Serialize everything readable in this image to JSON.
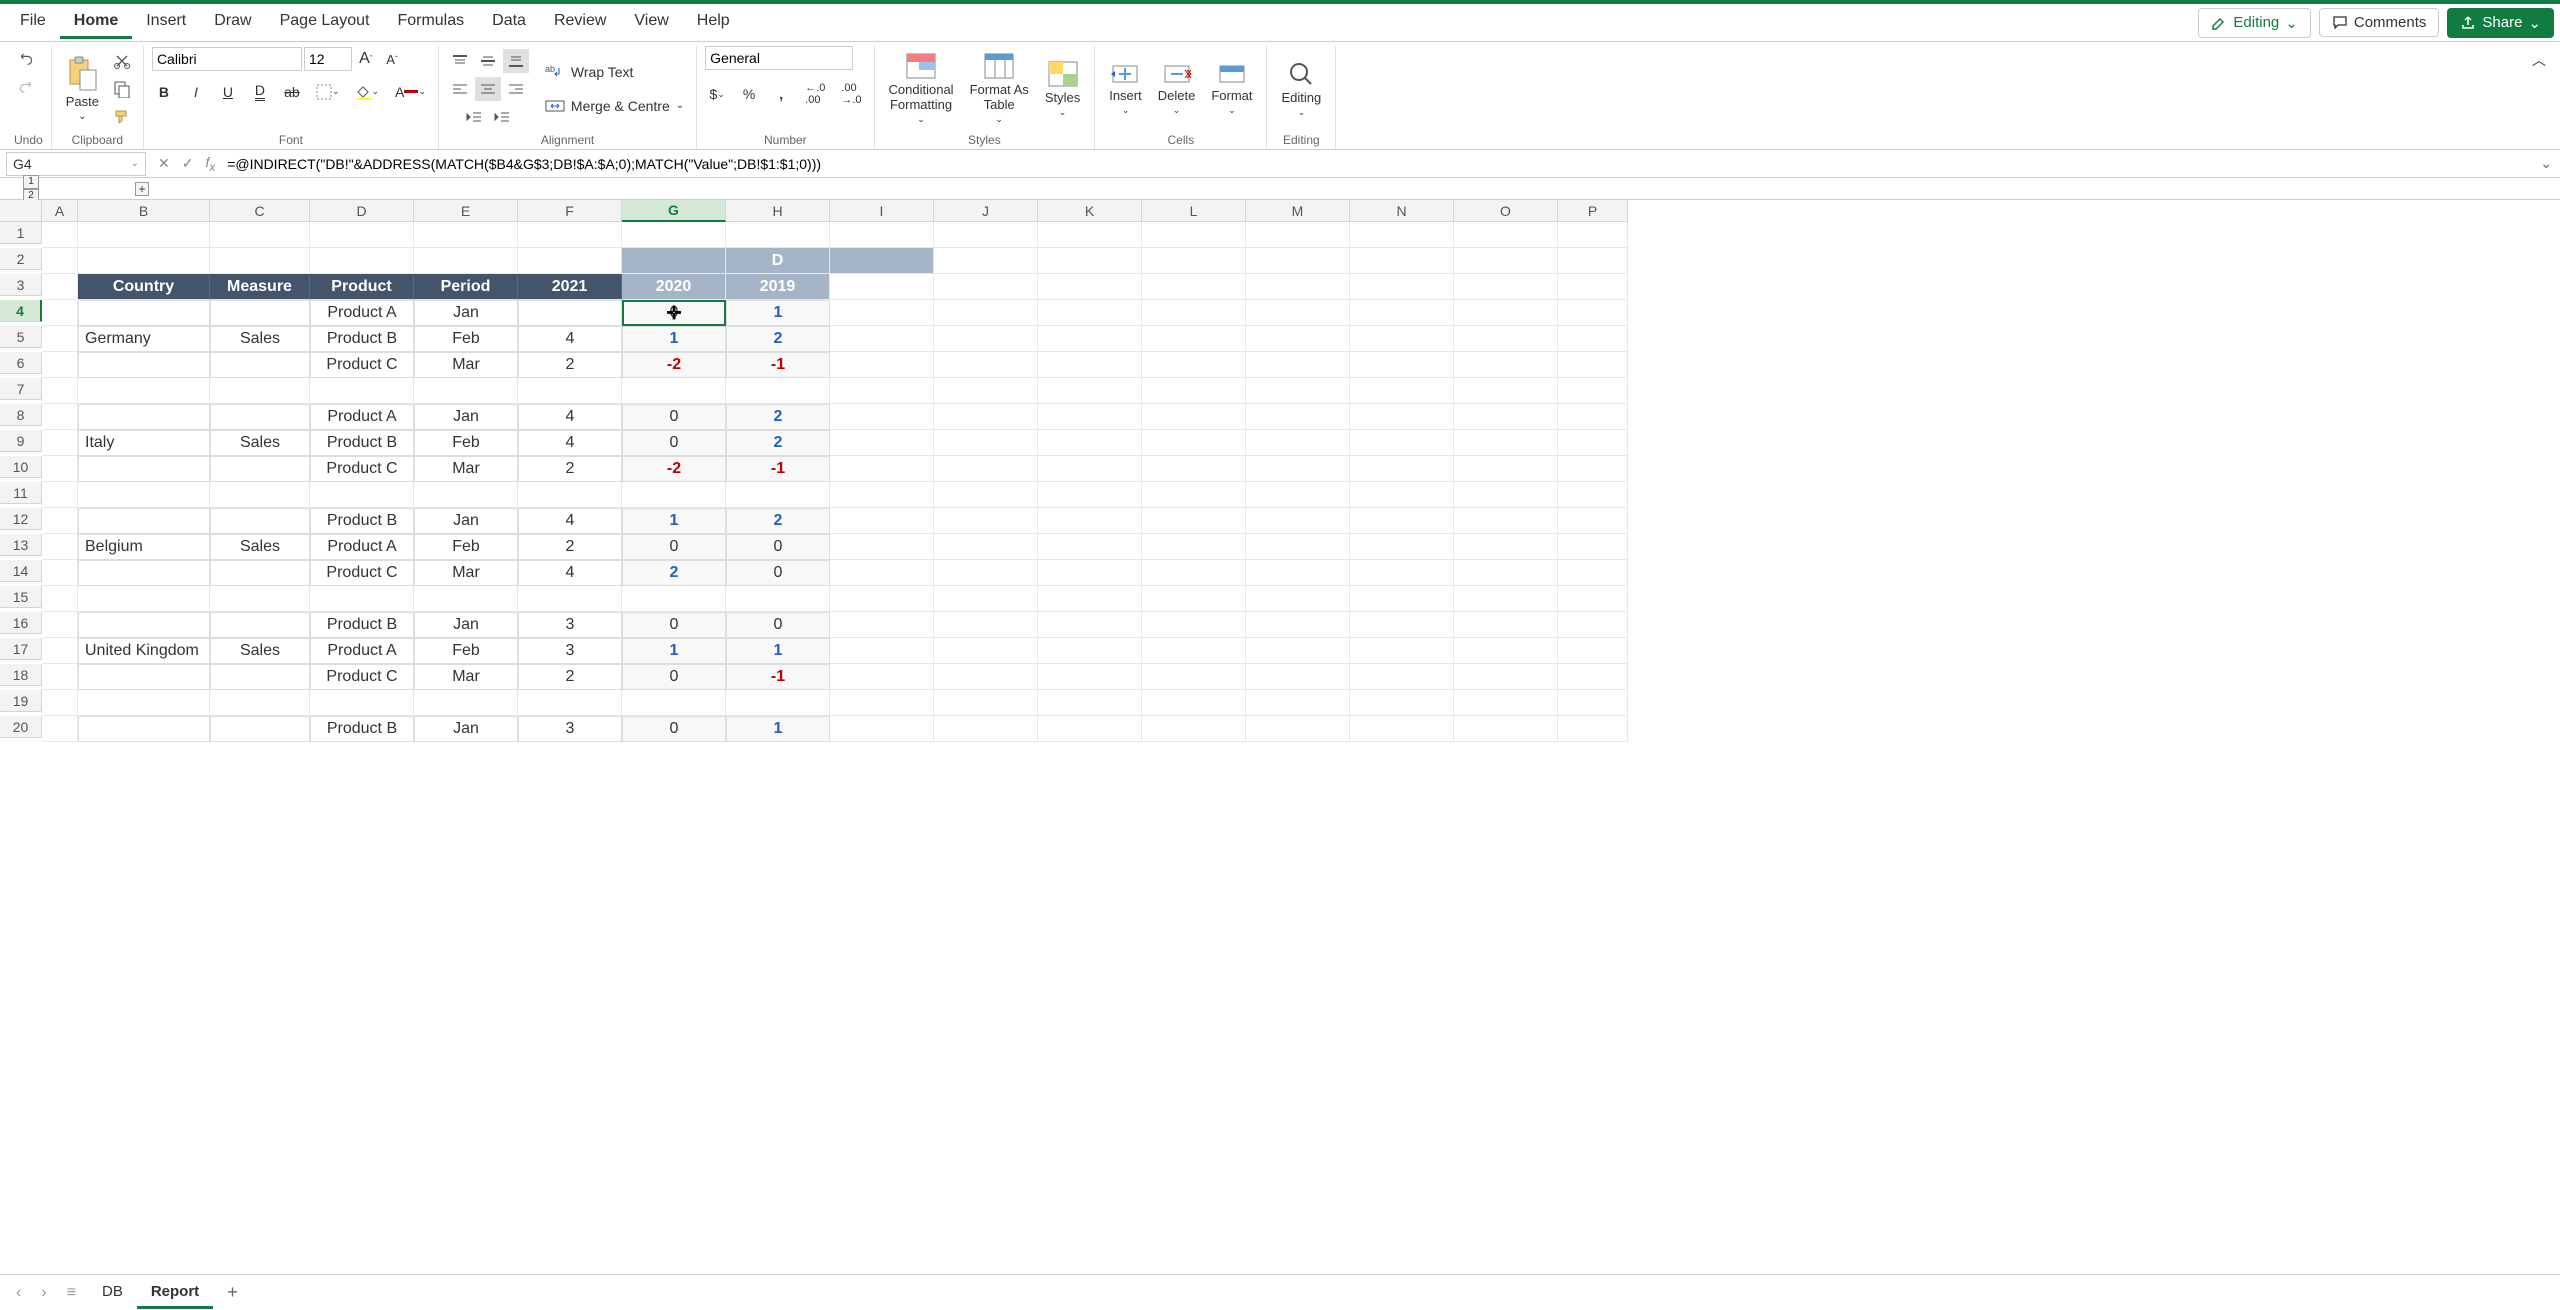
{
  "menu": {
    "items": [
      "File",
      "Home",
      "Insert",
      "Draw",
      "Page Layout",
      "Formulas",
      "Data",
      "Review",
      "View",
      "Help"
    ],
    "active": "Home"
  },
  "actions": {
    "editing": "Editing",
    "comments": "Comments",
    "share": "Share"
  },
  "ribbon": {
    "undo": "Undo",
    "clipboard": "Clipboard",
    "paste": "Paste",
    "font": {
      "label": "Font",
      "name": "Calibri",
      "size": "12"
    },
    "alignment": {
      "label": "Alignment",
      "wrap": "Wrap Text",
      "merge": "Merge & Centre"
    },
    "number": {
      "label": "Number",
      "format": "General"
    },
    "styles": {
      "label": "Styles",
      "cond": "Conditional\nFormatting",
      "table": "Format As\nTable",
      "styles": "Styles"
    },
    "cells": {
      "label": "Cells",
      "insert": "Insert",
      "delete": "Delete",
      "format": "Format"
    },
    "editing_grp": {
      "label": "Editing",
      "editing": "Editing"
    }
  },
  "namebox": "G4",
  "formula": "=@INDIRECT(\"DB!\"&ADDRESS(MATCH($B4&G$3;DB!$A:$A;0);MATCH(\"Value\";DB!$1:$1;0)))",
  "cols": [
    "A",
    "B",
    "C",
    "D",
    "E",
    "F",
    "G",
    "H",
    "I",
    "J",
    "K",
    "L",
    "M",
    "N",
    "O",
    "P"
  ],
  "rows": [
    1,
    2,
    3,
    4,
    5,
    6,
    7,
    8,
    9,
    10,
    11,
    12,
    13,
    14,
    15,
    16,
    17,
    18,
    19,
    20
  ],
  "selected": {
    "col": "G",
    "row": 4
  },
  "table": {
    "ext_header": "D",
    "headers": [
      "Country",
      "Measure",
      "Product",
      "Period",
      "2021",
      "2020",
      "2019"
    ],
    "groups": [
      {
        "country": "Germany",
        "measure": "Sales",
        "rows": [
          {
            "product": "Product A",
            "period": "Jan",
            "y2021": "",
            "y2020": "0",
            "y2019": "1"
          },
          {
            "product": "Product B",
            "period": "Feb",
            "y2021": "4",
            "y2020": "1",
            "y2019": "2"
          },
          {
            "product": "Product C",
            "period": "Mar",
            "y2021": "2",
            "y2020": "-2",
            "y2019": "-1"
          }
        ]
      },
      {
        "country": "Italy",
        "measure": "Sales",
        "rows": [
          {
            "product": "Product A",
            "period": "Jan",
            "y2021": "4",
            "y2020": "0",
            "y2019": "2"
          },
          {
            "product": "Product B",
            "period": "Feb",
            "y2021": "4",
            "y2020": "0",
            "y2019": "2"
          },
          {
            "product": "Product C",
            "period": "Mar",
            "y2021": "2",
            "y2020": "-2",
            "y2019": "-1"
          }
        ]
      },
      {
        "country": "Belgium",
        "measure": "Sales",
        "rows": [
          {
            "product": "Product B",
            "period": "Jan",
            "y2021": "4",
            "y2020": "1",
            "y2019": "2"
          },
          {
            "product": "Product A",
            "period": "Feb",
            "y2021": "2",
            "y2020": "0",
            "y2019": "0"
          },
          {
            "product": "Product C",
            "period": "Mar",
            "y2021": "4",
            "y2020": "2",
            "y2019": "0"
          }
        ]
      },
      {
        "country": "United Kingdom",
        "measure": "Sales",
        "rows": [
          {
            "product": "Product B",
            "period": "Jan",
            "y2021": "3",
            "y2020": "0",
            "y2019": "0"
          },
          {
            "product": "Product A",
            "period": "Feb",
            "y2021": "3",
            "y2020": "1",
            "y2019": "1"
          },
          {
            "product": "Product C",
            "period": "Mar",
            "y2021": "2",
            "y2020": "0",
            "y2019": "-1"
          }
        ]
      },
      {
        "country": "",
        "measure": "",
        "rows": [
          {
            "product": "Product B",
            "period": "Jan",
            "y2021": "3",
            "y2020": "0",
            "y2019": "1"
          }
        ]
      }
    ]
  },
  "tabs": {
    "items": [
      "DB",
      "Report"
    ],
    "active": "Report"
  }
}
